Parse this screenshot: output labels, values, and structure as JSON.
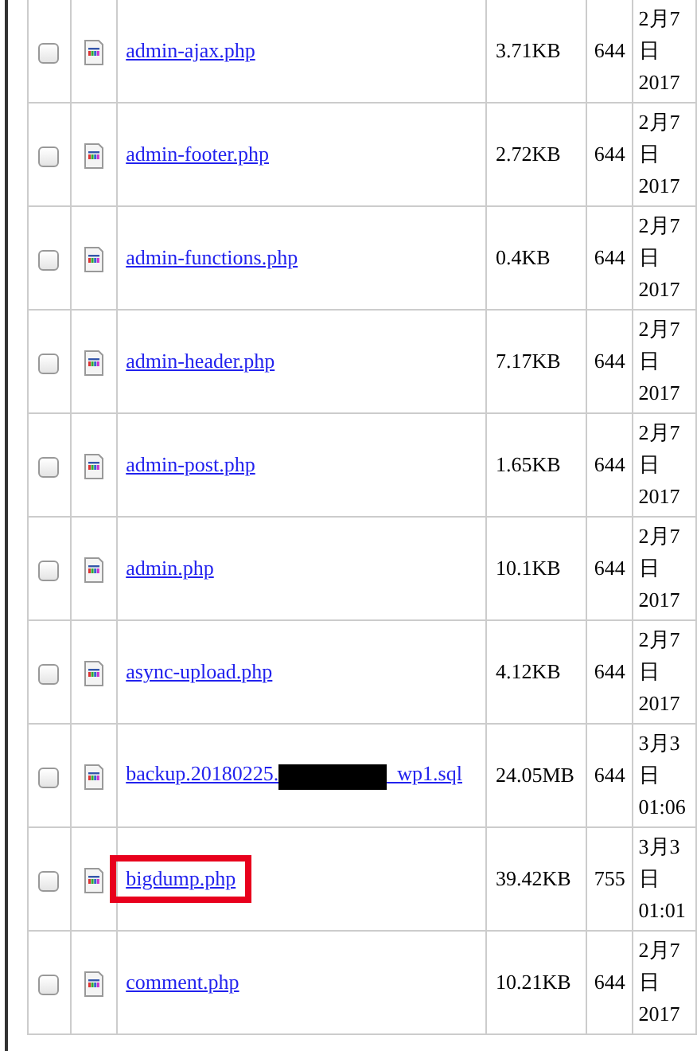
{
  "files": [
    {
      "checked": false,
      "name": "admin-ajax.php",
      "size": "3.71KB",
      "permissions": "644",
      "modified": "2月7日 2017",
      "highlighted": false
    },
    {
      "checked": false,
      "name": "admin-footer.php",
      "size": "2.72KB",
      "permissions": "644",
      "modified": "2月7日 2017",
      "highlighted": false
    },
    {
      "checked": false,
      "name": "admin-functions.php",
      "size": "0.4KB",
      "permissions": "644",
      "modified": "2月7日 2017",
      "highlighted": false
    },
    {
      "checked": false,
      "name": "admin-header.php",
      "size": "7.17KB",
      "permissions": "644",
      "modified": "2月7日 2017",
      "highlighted": false
    },
    {
      "checked": false,
      "name": "admin-post.php",
      "size": "1.65KB",
      "permissions": "644",
      "modified": "2月7日 2017",
      "highlighted": false
    },
    {
      "checked": false,
      "name": "admin.php",
      "size": "10.1KB",
      "permissions": "644",
      "modified": "2月7日 2017",
      "highlighted": false
    },
    {
      "checked": false,
      "name": "async-upload.php",
      "size": "4.12KB",
      "permissions": "644",
      "modified": "2月7日 2017",
      "highlighted": false
    },
    {
      "checked": false,
      "name": "backup.20180225.",
      "name_end": "_wp1.sql",
      "redacted": true,
      "size": "24.05MB",
      "permissions": "644",
      "modified": "3月3日 01:06",
      "highlighted": false
    },
    {
      "checked": false,
      "name": "bigdump.php",
      "size": "39.42KB",
      "permissions": "755",
      "modified": "3月3日 01:01",
      "highlighted": true
    },
    {
      "checked": false,
      "name": "comment.php",
      "size": "10.21KB",
      "permissions": "644",
      "modified": "2月7日 2017",
      "highlighted": false
    }
  ]
}
